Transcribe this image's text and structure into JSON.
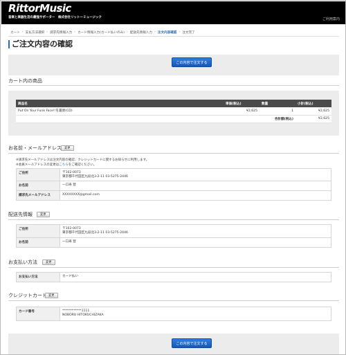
{
  "header": {
    "logo": "RittorMusic",
    "tagline": "音楽と楽器生活の最強サポーター　株式会社リットーミュージック",
    "link": "ご利用案内"
  },
  "breadcrumb": [
    {
      "label": "カート",
      "active": false
    },
    {
      "label": "支払方法選択",
      "active": false
    },
    {
      "label": "請求先情報入力",
      "active": false
    },
    {
      "label": "カード情報入力(カード払いのみ)",
      "active": false
    },
    {
      "label": "配送先情報入力",
      "active": false
    },
    {
      "label": "注文内容確認",
      "active": true
    },
    {
      "label": "注文完了",
      "active": false
    }
  ],
  "page_title": "ご注文内容の確認",
  "buttons": {
    "order_top": "この内容で注文する",
    "order_bottom": "この内容で注文する",
    "change": "変更"
  },
  "products": {
    "heading": "カート内の商品",
    "columns": [
      "商品名",
      "単価(税込)",
      "数量",
      "小計(税込)"
    ],
    "rows": [
      {
        "name": "Put On Your Funk Face!!を最新(CD)",
        "price": "¥2,625",
        "qty": "1",
        "subtotal": "¥2,625"
      }
    ],
    "total_label": "合計額(税込)",
    "total_value": "¥2,625"
  },
  "contact": {
    "heading": "お名前・メールアドレス",
    "notes": [
      "※請求先メールアドレスは注文内容の確認、クレジットカードに関するお知らせに利用します。",
      "※会員メールアドレスの変更は",
      "こちら",
      "をご確認ください。"
    ],
    "rows": [
      {
        "label": "ご住所",
        "line1": "〒102-0073",
        "line2": "東京都千代田区九段北3-2-11 03-5275-2446"
      },
      {
        "label": "お名前",
        "line1": "一口寿 登",
        "line2": ""
      },
      {
        "label": "請求先メールアドレス",
        "line1": "XXXXXXXX@gmail.com",
        "line2": ""
      }
    ]
  },
  "shipping": {
    "heading": "配送先情報",
    "rows": [
      {
        "label": "ご住所",
        "line1": "〒102-0073",
        "line2": "東京都千代田区九段北3-2-11 03-5275-2446"
      },
      {
        "label": "お名前",
        "line1": "一口寿 登",
        "line2": ""
      }
    ]
  },
  "payment": {
    "heading": "お支払い方法",
    "rows": [
      {
        "label": "お支払い方法",
        "line1": "カード払い",
        "line2": ""
      }
    ]
  },
  "card": {
    "heading": "クレジットカード",
    "rows": [
      {
        "label": "カード番号",
        "line1": "************1111",
        "line2": "NOBORU HITOKUCHIZAKA"
      }
    ]
  }
}
